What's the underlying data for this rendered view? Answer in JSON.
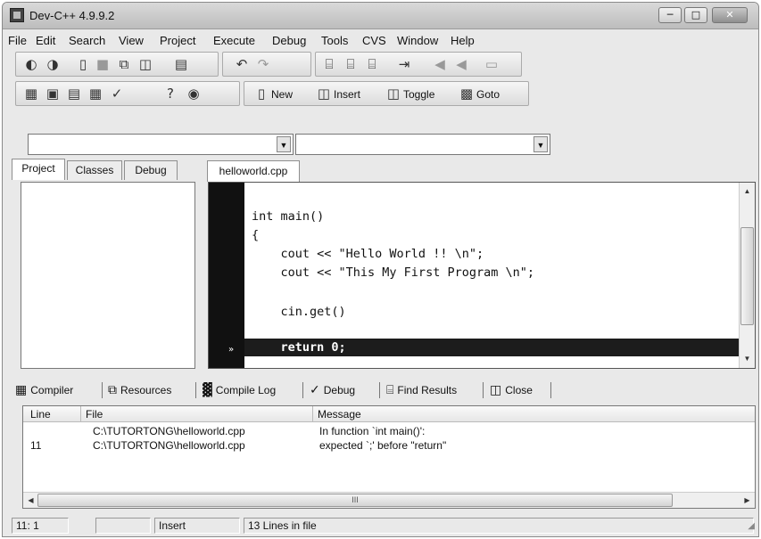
{
  "window": {
    "title": "Dev-C++ 4.9.9.2"
  },
  "menu": [
    "File",
    "Edit",
    "Search",
    "View",
    "Project",
    "Execute",
    "Debug",
    "Tools",
    "CVS",
    "Window",
    "Help"
  ],
  "toolbar": {
    "new_label": "New",
    "insert_label": "Insert",
    "toggle_label": "Toggle",
    "goto_label": "Goto"
  },
  "class_combo": {
    "value": ""
  },
  "member_combo": {
    "value": ""
  },
  "left_tabs": [
    "Project",
    "Classes",
    "Debug"
  ],
  "editor": {
    "tab_label": "helloworld.cpp",
    "lines": [
      "int main()",
      "{",
      "    cout << \"Hello World !! \\n\";",
      "    cout << \"This My First Program \\n\";",
      "",
      "    cin.get()",
      ""
    ],
    "error_line": "    return 0;"
  },
  "bottom_tabs": [
    "Compiler",
    "Resources",
    "Compile Log",
    "Debug",
    "Find Results",
    "Close"
  ],
  "results": {
    "headers": [
      "Line",
      "File",
      "Message"
    ],
    "rows": [
      {
        "line": "",
        "file": "C:\\TUTORTONG\\helloworld.cpp",
        "message": "In function `int main()':"
      },
      {
        "line": "11",
        "file": "C:\\TUTORTONG\\helloworld.cpp",
        "message": "expected `;' before \"return\""
      }
    ],
    "scroll_glyph": "III"
  },
  "status": {
    "position": "11: 1",
    "modified": "",
    "mode": "Insert",
    "info": "13 Lines in file"
  }
}
